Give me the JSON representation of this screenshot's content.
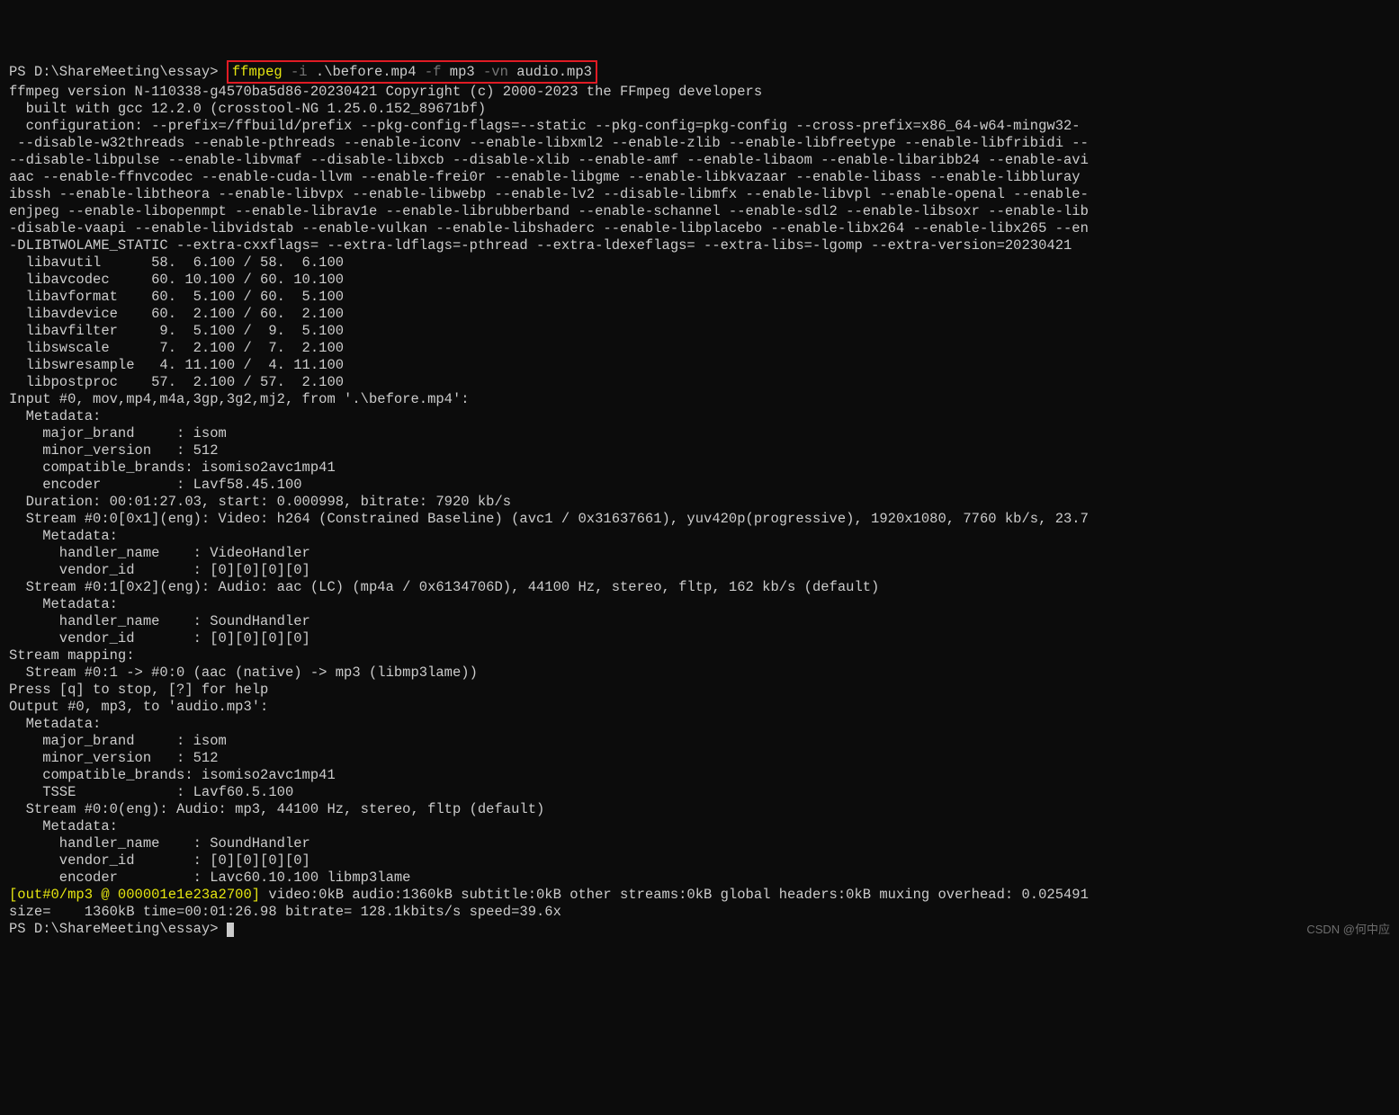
{
  "prompt1": "PS D:\\ShareMeeting\\essay>",
  "cmd": {
    "p1": "ffmpeg",
    "p2": "-i",
    "p3": ".\\before.mp4",
    "p4": "-f",
    "p5": "mp3",
    "p6": "-vn",
    "p7": "audio.mp3"
  },
  "l1": "ffmpeg version N-110338-g4570ba5d86-20230421 Copyright (c) 2000-2023 the FFmpeg developers",
  "l2": "  built with gcc 12.2.0 (crosstool-NG 1.25.0.152_89671bf)",
  "l3": "  configuration: --prefix=/ffbuild/prefix --pkg-config-flags=--static --pkg-config=pkg-config --cross-prefix=x86_64-w64-mingw32-",
  "l4": " --disable-w32threads --enable-pthreads --enable-iconv --enable-libxml2 --enable-zlib --enable-libfreetype --enable-libfribidi --",
  "l5": "--disable-libpulse --enable-libvmaf --disable-libxcb --disable-xlib --enable-amf --enable-libaom --enable-libaribb24 --enable-avi",
  "l6": "aac --enable-ffnvcodec --enable-cuda-llvm --enable-frei0r --enable-libgme --enable-libkvazaar --enable-libass --enable-libbluray",
  "l7": "ibssh --enable-libtheora --enable-libvpx --enable-libwebp --enable-lv2 --disable-libmfx --enable-libvpl --enable-openal --enable-",
  "l8": "enjpeg --enable-libopenmpt --enable-librav1e --enable-librubberband --enable-schannel --enable-sdl2 --enable-libsoxr --enable-lib",
  "l9": "-disable-vaapi --enable-libvidstab --enable-vulkan --enable-libshaderc --enable-libplacebo --enable-libx264 --enable-libx265 --en",
  "l10": "-DLIBTWOLAME_STATIC --extra-cxxflags= --extra-ldflags=-pthread --extra-ldexeflags= --extra-libs=-lgomp --extra-version=20230421",
  "libs": {
    "a": "  libavutil      58.  6.100 / 58.  6.100",
    "b": "  libavcodec     60. 10.100 / 60. 10.100",
    "c": "  libavformat    60.  5.100 / 60.  5.100",
    "d": "  libavdevice    60.  2.100 / 60.  2.100",
    "e": "  libavfilter     9.  5.100 /  9.  5.100",
    "f": "  libswscale      7.  2.100 /  7.  2.100",
    "g": "  libswresample   4. 11.100 /  4. 11.100",
    "h": "  libpostproc    57.  2.100 / 57.  2.100"
  },
  "in0": "Input #0, mov,mp4,m4a,3gp,3g2,mj2, from '.\\before.mp4':",
  "m1": "  Metadata:",
  "m2": "    major_brand     : isom",
  "m3": "    minor_version   : 512",
  "m4": "    compatible_brands: isomiso2avc1mp41",
  "m5": "    encoder         : Lavf58.45.100",
  "dur": "  Duration: 00:01:27.03, start: 0.000998, bitrate: 7920 kb/s",
  "s00": "  Stream #0:0[0x1](eng): Video: h264 (Constrained Baseline) (avc1 / 0x31637661), yuv420p(progressive), 1920x1080, 7760 kb/s, 23.7",
  "s00m": "    Metadata:",
  "s00h": "      handler_name    : VideoHandler",
  "s00v": "      vendor_id       : [0][0][0][0]",
  "s01": "  Stream #0:1[0x2](eng): Audio: aac (LC) (mp4a / 0x6134706D), 44100 Hz, stereo, fltp, 162 kb/s (default)",
  "s01m": "    Metadata:",
  "s01h": "      handler_name    : SoundHandler",
  "s01v": "      vendor_id       : [0][0][0][0]",
  "smap": "Stream mapping:",
  "smap1": "  Stream #0:1 -> #0:0 (aac (native) -> mp3 (libmp3lame))",
  "press": "Press [q] to stop, [?] for help",
  "out0": "Output #0, mp3, to 'audio.mp3':",
  "om1": "  Metadata:",
  "om2": "    major_brand     : isom",
  "om3": "    minor_version   : 512",
  "om4": "    compatible_brands: isomiso2avc1mp41",
  "om5": "    TSSE            : Lavf60.5.100",
  "os0": "  Stream #0:0(eng): Audio: mp3, 44100 Hz, stereo, fltp (default)",
  "os0m": "    Metadata:",
  "os0h": "      handler_name    : SoundHandler",
  "os0v": "      vendor_id       : [0][0][0][0]",
  "os0e": "      encoder         : Lavc60.10.100 libmp3lame",
  "outy1": "[out#0/mp3 @ 000001e1e23a2700]",
  "outy1b": " video:0kB audio:1360kB subtitle:0kB other streams:0kB global headers:0kB muxing overhead: 0.025491",
  "size": "size=    1360kB time=00:01:26.98 bitrate= 128.1kbits/s speed=39.6x",
  "prompt2": "PS D:\\ShareMeeting\\essay>",
  "watermark": "CSDN @何中应"
}
